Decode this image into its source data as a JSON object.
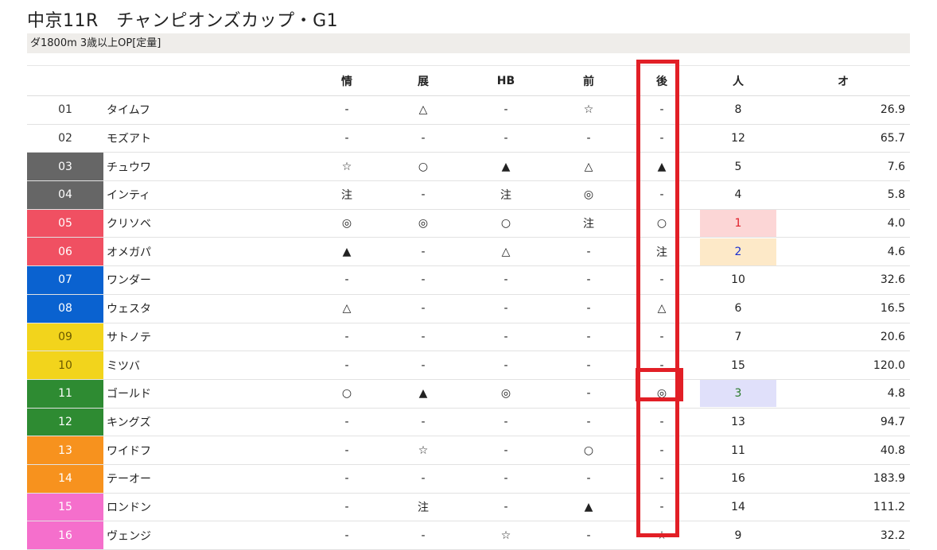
{
  "race": {
    "title": "中京11R　チャンピオンズカップ・G1",
    "subtitle": "ダ1800m  3歳以上OP[定量]"
  },
  "table": {
    "headers": [
      "",
      "",
      "情",
      "展",
      "HB",
      "前",
      "後",
      "人",
      "オ"
    ],
    "rows": [
      {
        "num": "01",
        "name": "タイムフ",
        "c1": "-",
        "c2": "△",
        "c3": "-",
        "c4": "☆",
        "c5": "-",
        "pop": "8",
        "odds": "26.9"
      },
      {
        "num": "02",
        "name": "モズアト",
        "c1": "-",
        "c2": "-",
        "c3": "-",
        "c4": "-",
        "c5": "-",
        "pop": "12",
        "odds": "65.7"
      },
      {
        "num": "03",
        "name": "チュウワ",
        "c1": "☆",
        "c2": "○",
        "c3": "▲",
        "c4": "△",
        "c5": "▲",
        "pop": "5",
        "odds": "7.6"
      },
      {
        "num": "04",
        "name": "インティ",
        "c1": "注",
        "c2": "-",
        "c3": "注",
        "c4": "◎",
        "c5": "-",
        "pop": "4",
        "odds": "5.8"
      },
      {
        "num": "05",
        "name": "クリソベ",
        "c1": "◎",
        "c2": "◎",
        "c3": "○",
        "c4": "注",
        "c5": "○",
        "pop": "1",
        "odds": "4.0"
      },
      {
        "num": "06",
        "name": "オメガパ",
        "c1": "▲",
        "c2": "-",
        "c3": "△",
        "c4": "-",
        "c5": "注",
        "pop": "2",
        "odds": "4.6"
      },
      {
        "num": "07",
        "name": "ワンダー",
        "c1": "-",
        "c2": "-",
        "c3": "-",
        "c4": "-",
        "c5": "-",
        "pop": "10",
        "odds": "32.6"
      },
      {
        "num": "08",
        "name": "ウェスタ",
        "c1": "△",
        "c2": "-",
        "c3": "-",
        "c4": "-",
        "c5": "△",
        "pop": "6",
        "odds": "16.5"
      },
      {
        "num": "09",
        "name": "サトノテ",
        "c1": "-",
        "c2": "-",
        "c3": "-",
        "c4": "-",
        "c5": "-",
        "pop": "7",
        "odds": "20.6"
      },
      {
        "num": "10",
        "name": "ミツバ",
        "c1": "-",
        "c2": "-",
        "c3": "-",
        "c4": "-",
        "c5": "-",
        "pop": "15",
        "odds": "120.0"
      },
      {
        "num": "11",
        "name": "ゴールド",
        "c1": "○",
        "c2": "▲",
        "c3": "◎",
        "c4": "-",
        "c5": "◎",
        "pop": "3",
        "odds": "4.8"
      },
      {
        "num": "12",
        "name": "キングズ",
        "c1": "-",
        "c2": "-",
        "c3": "-",
        "c4": "-",
        "c5": "-",
        "pop": "13",
        "odds": "94.7"
      },
      {
        "num": "13",
        "name": "ワイドフ",
        "c1": "-",
        "c2": "☆",
        "c3": "-",
        "c4": "○",
        "c5": "-",
        "pop": "11",
        "odds": "40.8"
      },
      {
        "num": "14",
        "name": "テーオー",
        "c1": "-",
        "c2": "-",
        "c3": "-",
        "c4": "-",
        "c5": "-",
        "pop": "16",
        "odds": "183.9"
      },
      {
        "num": "15",
        "name": "ロンドン",
        "c1": "-",
        "c2": "注",
        "c3": "-",
        "c4": "▲",
        "c5": "-",
        "pop": "14",
        "odds": "111.2"
      },
      {
        "num": "16",
        "name": "ヴェンジ",
        "c1": "-",
        "c2": "-",
        "c3": "☆",
        "c4": "-",
        "c5": "☆",
        "pop": "9",
        "odds": "32.2"
      }
    ]
  },
  "colors": {
    "frame": [
      "#ffffff",
      "#ffffff",
      "#666666",
      "#666666",
      "#f05062",
      "#f05062",
      "#0a62d0",
      "#0a62d0",
      "#f2d41c",
      "#f2d41c",
      "#2e8b32",
      "#2e8b32",
      "#f7921e",
      "#f7921e",
      "#f56fcc",
      "#f56fcc"
    ],
    "frame_text": [
      "#333333",
      "#333333",
      "#ffffff",
      "#ffffff",
      "#ffffff",
      "#ffffff",
      "#ffffff",
      "#ffffff",
      "#6b5a00",
      "#6b5a00",
      "#ffffff",
      "#ffffff",
      "#ffffff",
      "#ffffff",
      "#ffffff",
      "#ffffff"
    ],
    "pop1_bg": "#fcd6d6",
    "pop1_fg": "#e0202a",
    "pop2_bg": "#fde9c8",
    "pop2_fg": "#1a2fd0",
    "pop3_bg": "#e0e0fa",
    "pop3_fg": "#2a7a2a",
    "highlight": "#e21f26"
  }
}
